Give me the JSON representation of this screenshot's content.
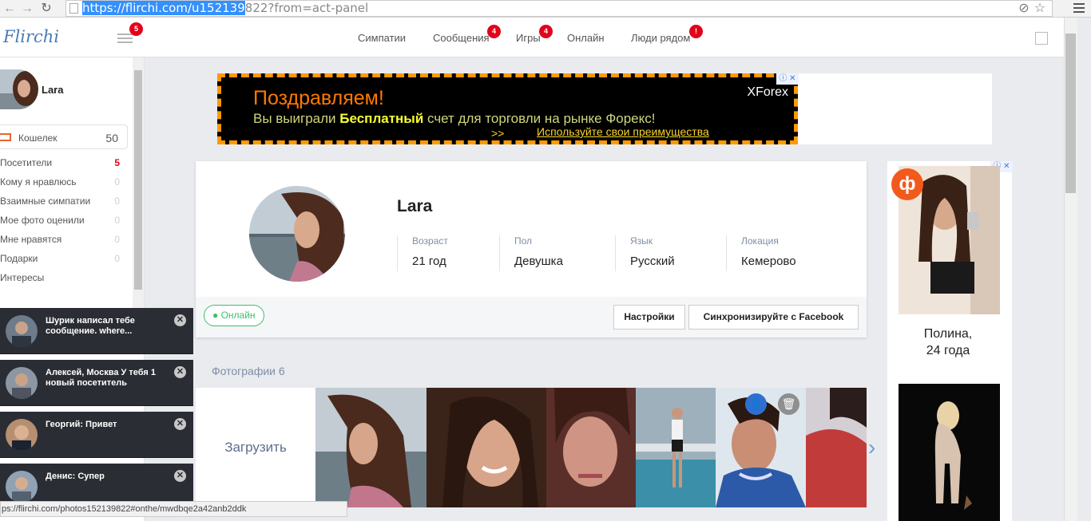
{
  "browser": {
    "url_selected": "https://flirchi.com/u152139",
    "url_rest": "822?from=act-panel"
  },
  "topnav": {
    "logo": "Flirchi",
    "menu_badge": "5",
    "links": [
      {
        "label": "Симпатии",
        "badge": ""
      },
      {
        "label": "Сообщения",
        "badge": "4"
      },
      {
        "label": "Игры",
        "badge": "4"
      },
      {
        "label": "Онлайн",
        "badge": ""
      },
      {
        "label": "Люди рядом",
        "badge": "!"
      }
    ]
  },
  "sidebar": {
    "user_name": "Lara",
    "wallet": {
      "label": "Кошелек",
      "value": "50"
    },
    "items": [
      {
        "label": "Посетители",
        "count": "5"
      },
      {
        "label": "Кому я нравлюсь",
        "count": "0"
      },
      {
        "label": "Взаимные симпатии",
        "count": "0"
      },
      {
        "label": "Мое фото оценили",
        "count": "0"
      },
      {
        "label": "Мне нравятся",
        "count": "0"
      },
      {
        "label": "Подарки",
        "count": "0"
      },
      {
        "label": "Интересы",
        "count": ""
      }
    ]
  },
  "notifications": [
    {
      "text": "Шурик написал тебе сообщение. where..."
    },
    {
      "text": "Алексей, Москва У тебя 1 новый посетитель"
    },
    {
      "text": "Георгий: Привет"
    },
    {
      "text": "Денис: Супер"
    }
  ],
  "ad_banner": {
    "title": "Поздравляем!",
    "sub_prefix": "Вы выиграли ",
    "sub_bold": "Бесплатный",
    "sub_suffix": " счет для торговли на рынке Форекс!",
    "arrow": ">>",
    "link": "Используйте свои преимущества",
    "brand": "XForex"
  },
  "profile": {
    "name": "Lara",
    "attributes": [
      {
        "label": "Возраст",
        "value": "21 год"
      },
      {
        "label": "Пол",
        "value": "Девушка"
      },
      {
        "label": "Язык",
        "value": "Русский"
      },
      {
        "label": "Локация",
        "value": "Кемерово"
      }
    ],
    "status": "Онлайн",
    "buttons": {
      "settings": "Настройки",
      "sync": "Синхронизируйте с Facebook"
    }
  },
  "photos": {
    "title": "Фотографии 6",
    "upload": "Загрузить"
  },
  "ad_right": {
    "logo": "ф",
    "name_line1": "Полина,",
    "name_line2": "24 года"
  },
  "statusbar": {
    "text": "ps://flirchi.com/photos152139822#onthe/mwdbqe2a42anb2ddk"
  },
  "colors": {
    "accent": "#4a7ab5",
    "badge": "#e3001b",
    "online": "#3cbf6d"
  }
}
